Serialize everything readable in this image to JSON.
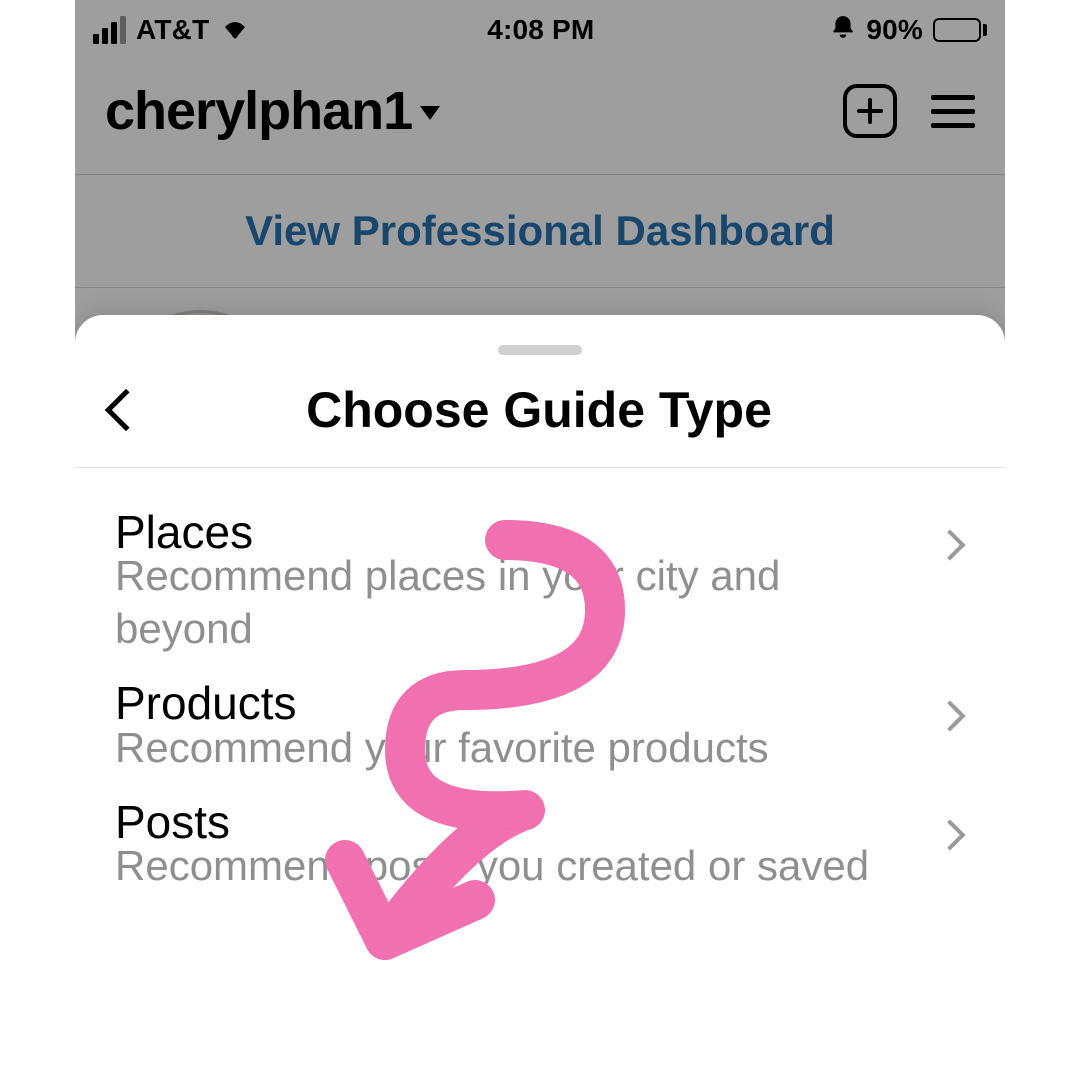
{
  "status_bar": {
    "carrier": "AT&T",
    "time": "4:08 PM",
    "battery_percent": "90%"
  },
  "profile": {
    "username": "cherylphan1",
    "dashboard_link": "View Professional Dashboard"
  },
  "sheet": {
    "title": "Choose Guide Type",
    "options": [
      {
        "title": "Places",
        "subtitle": "Recommend places in your city and beyond"
      },
      {
        "title": "Products",
        "subtitle": "Recommend your favorite products"
      },
      {
        "title": "Posts",
        "subtitle": "Recommend posts you created or saved"
      }
    ]
  },
  "colors": {
    "annotation": "#f070b0",
    "link": "#2872b0",
    "subtext": "#8f8f8f"
  }
}
